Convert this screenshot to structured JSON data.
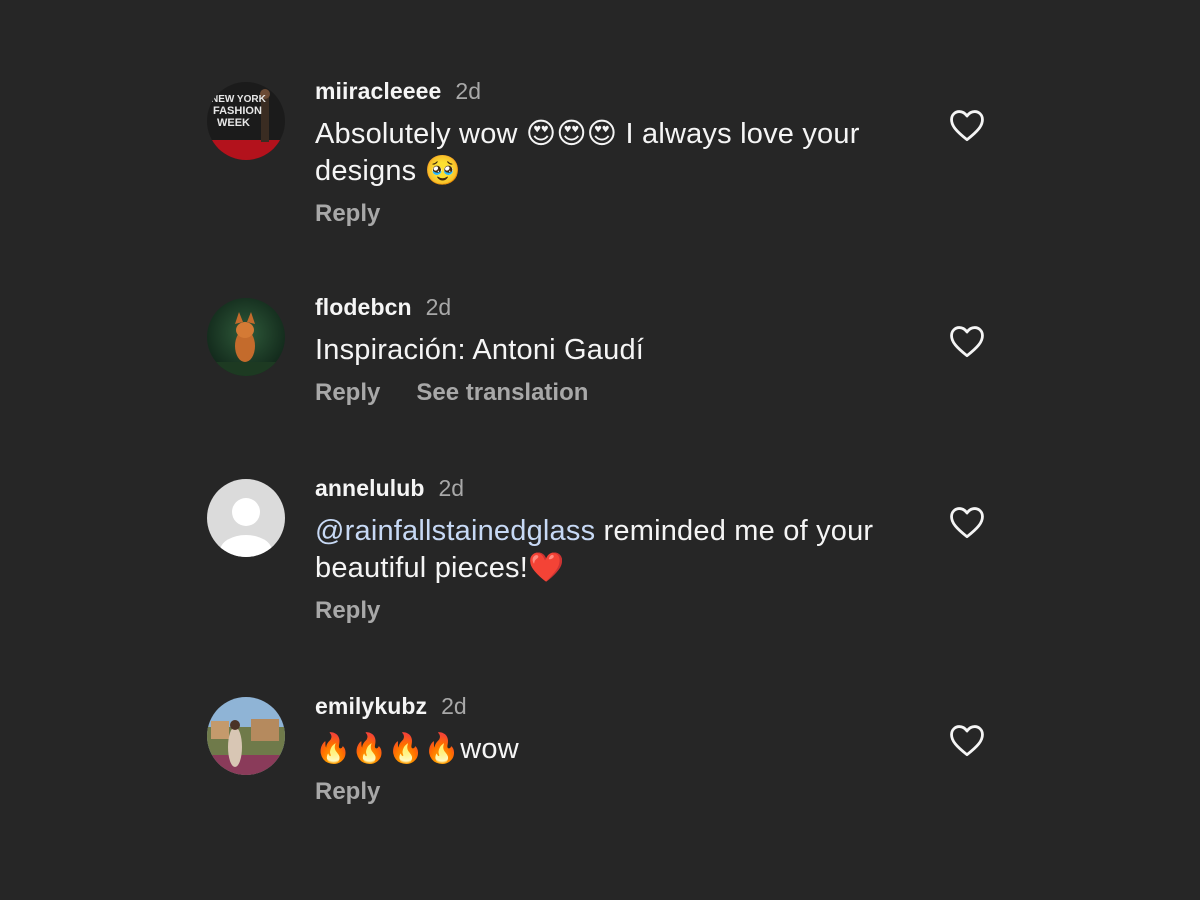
{
  "comments": [
    {
      "username": "miiracleeee",
      "time": "2d",
      "text_before": "Absolutely wow 😍😍😍 I always love your designs 🥹",
      "reply_label": "Reply",
      "avatar_text": "NEW YORK FASHION WEEK"
    },
    {
      "username": "flodebcn",
      "time": "2d",
      "text_before": "Inspiración: Antoni Gaudí",
      "reply_label": "Reply",
      "translate_label": "See translation"
    },
    {
      "username": "annelulub",
      "time": "2d",
      "mention": "@rainfallstainedglass",
      "text_after": " reminded me of your beautiful pieces!❤️",
      "reply_label": "Reply"
    },
    {
      "username": "emilykubz",
      "time": "2d",
      "text_before": "🔥🔥🔥🔥wow",
      "reply_label": "Reply"
    }
  ],
  "colors": {
    "background": "#262626",
    "text": "#f5f5f5",
    "secondary": "#a8a8a8",
    "mention": "#c7d9f5"
  },
  "icons": {
    "like": "heart-outline-icon",
    "default_avatar": "default-user-icon"
  }
}
